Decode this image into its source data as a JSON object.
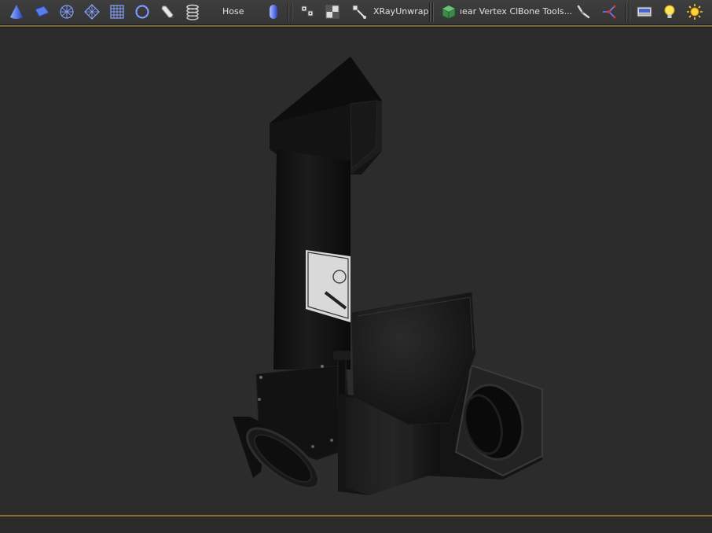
{
  "toolbar": {
    "tools": [
      {
        "icon": "cone-icon"
      },
      {
        "icon": "plane-icon"
      },
      {
        "icon": "geosphere-icon"
      },
      {
        "icon": "diamond-grid-icon"
      },
      {
        "icon": "grid-icon"
      },
      {
        "icon": "torus-icon"
      },
      {
        "icon": "pen-tool-icon"
      },
      {
        "icon": "spring-icon"
      }
    ],
    "hose_label": "Hose",
    "capsule_icon": "capsule-icon",
    "unwrap_tools": [
      {
        "icon": "uv-scatter-icon"
      },
      {
        "icon": "uv-checker-icon"
      }
    ],
    "xray_label": "XRayUnwrap",
    "box_icon": "green-box-icon",
    "vertex_label": "ıear Vertex Clı",
    "bone_label": "Bone Tools...",
    "bone_icons": [
      {
        "icon": "bone-chain-icon"
      },
      {
        "icon": "bone-branch-icon"
      }
    ],
    "render_icons": [
      {
        "icon": "render-setup-icon"
      },
      {
        "icon": "light-bulb-icon"
      },
      {
        "icon": "sun-icon"
      }
    ]
  },
  "viewport": {
    "object": "3d-duct-pipe-model",
    "background_color": "#2c2c2c"
  },
  "colors": {
    "toolbar_bg": "#3a3a3a",
    "accent": "#8a7232",
    "text": "#e0e0e0"
  }
}
